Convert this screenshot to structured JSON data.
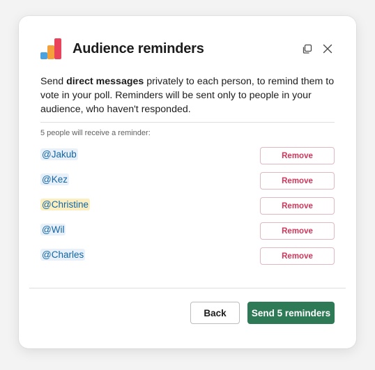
{
  "header": {
    "title": "Audience reminders",
    "logo_icon": "poll-bars-logo",
    "popout_icon": "popout-icon",
    "close_icon": "close-icon",
    "logo_colors": [
      "#4aa3df",
      "#f4a13b",
      "#e8435a"
    ]
  },
  "intro": {
    "prefix": "Send ",
    "bold": "direct messages",
    "suffix": " privately to each person, to remind them to vote in your poll. Reminders will be sent only to people in your audience, who haven't responded."
  },
  "recipients": {
    "count_text": "5 people will receive a reminder:",
    "remove_label": "Remove",
    "list": [
      {
        "name": "@Jakub",
        "highlighted": false
      },
      {
        "name": "@Kez",
        "highlighted": false
      },
      {
        "name": "@Christine",
        "highlighted": true
      },
      {
        "name": "@Wil",
        "highlighted": false
      },
      {
        "name": "@Charles",
        "highlighted": false
      }
    ]
  },
  "footer": {
    "back_label": "Back",
    "send_label": "Send 5 reminders",
    "send_color": "#2e7a57"
  }
}
